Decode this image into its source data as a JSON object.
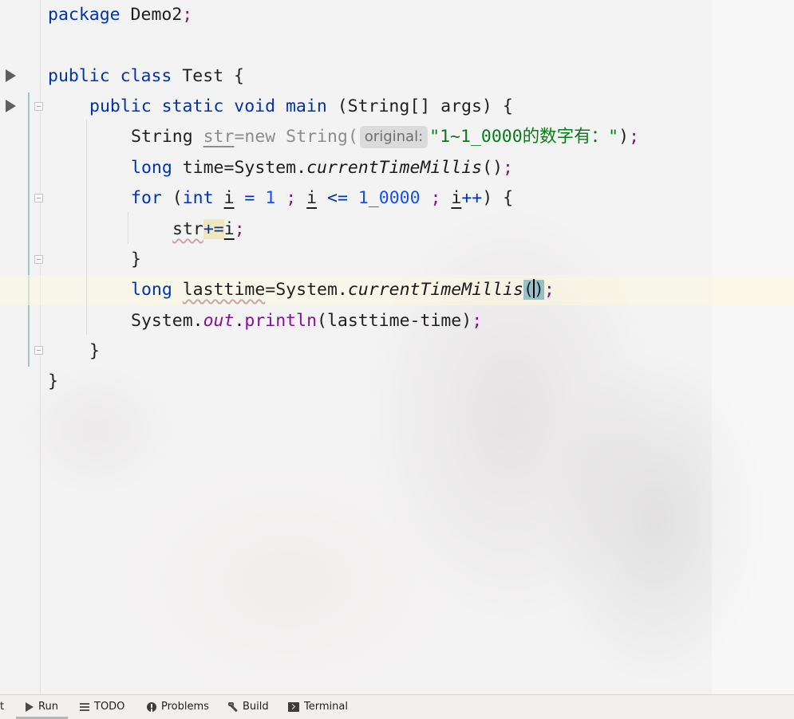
{
  "editor": {
    "lines": {
      "l1": {
        "kw": "package",
        "rest": " Demo2",
        "semi": ";"
      },
      "l3": {
        "kw1": "public",
        "kw2": "class",
        "name": " Test {"
      },
      "l4": {
        "kw1": "public",
        "kw2": "static",
        "kw3": "void",
        "method": "main",
        "rest": " (String[] args) {"
      },
      "l5": {
        "type": "String ",
        "var": "str",
        "eq": "=",
        "new": "new String(",
        "hint": "original:",
        "str": "\"1~1_0000的数字有：\"",
        "close": ")",
        "semi": ";"
      },
      "l6": {
        "kw": "long",
        "rest": " time=System.",
        "method": "currentTimeMillis",
        "close": "()",
        "semi": ";"
      },
      "l7": {
        "kw": "for",
        "p1": " (",
        "int": "int",
        "i1": "i",
        "eq": " = ",
        "one": "1",
        "semi1": " ; ",
        "i2": "i",
        "le": " <= ",
        "lim": "1_0000",
        "semi2": " ; ",
        "i3": "i",
        "inc": "++",
        "end": ") {"
      },
      "l8": {
        "var": "str",
        "op": "+=",
        "i": "i",
        "semi": ";"
      },
      "l9": {
        "brace": "}"
      },
      "l10": {
        "kw": "long",
        "var": "lasttime",
        "rest": "=System.",
        "method": "currentTimeMillis",
        "open": "(",
        "close": ")",
        "semi": ";"
      },
      "l11": {
        "pre": "System.",
        "out": "out",
        "dot": ".",
        "println": "println",
        "arg": "(lasttime-time)",
        "semi": ";"
      },
      "l12": {
        "brace": "}"
      },
      "l13": {
        "brace": "}"
      }
    }
  },
  "toolbar": {
    "partial": "t",
    "run": "Run",
    "todo": "TODO",
    "problems": "Problems",
    "build": "Build",
    "terminal": "Terminal"
  },
  "icons": [
    "run-gutter-icon",
    "fold-icon",
    "run-icon",
    "list-icon",
    "problems-icon",
    "hammer-icon",
    "terminal-icon"
  ]
}
